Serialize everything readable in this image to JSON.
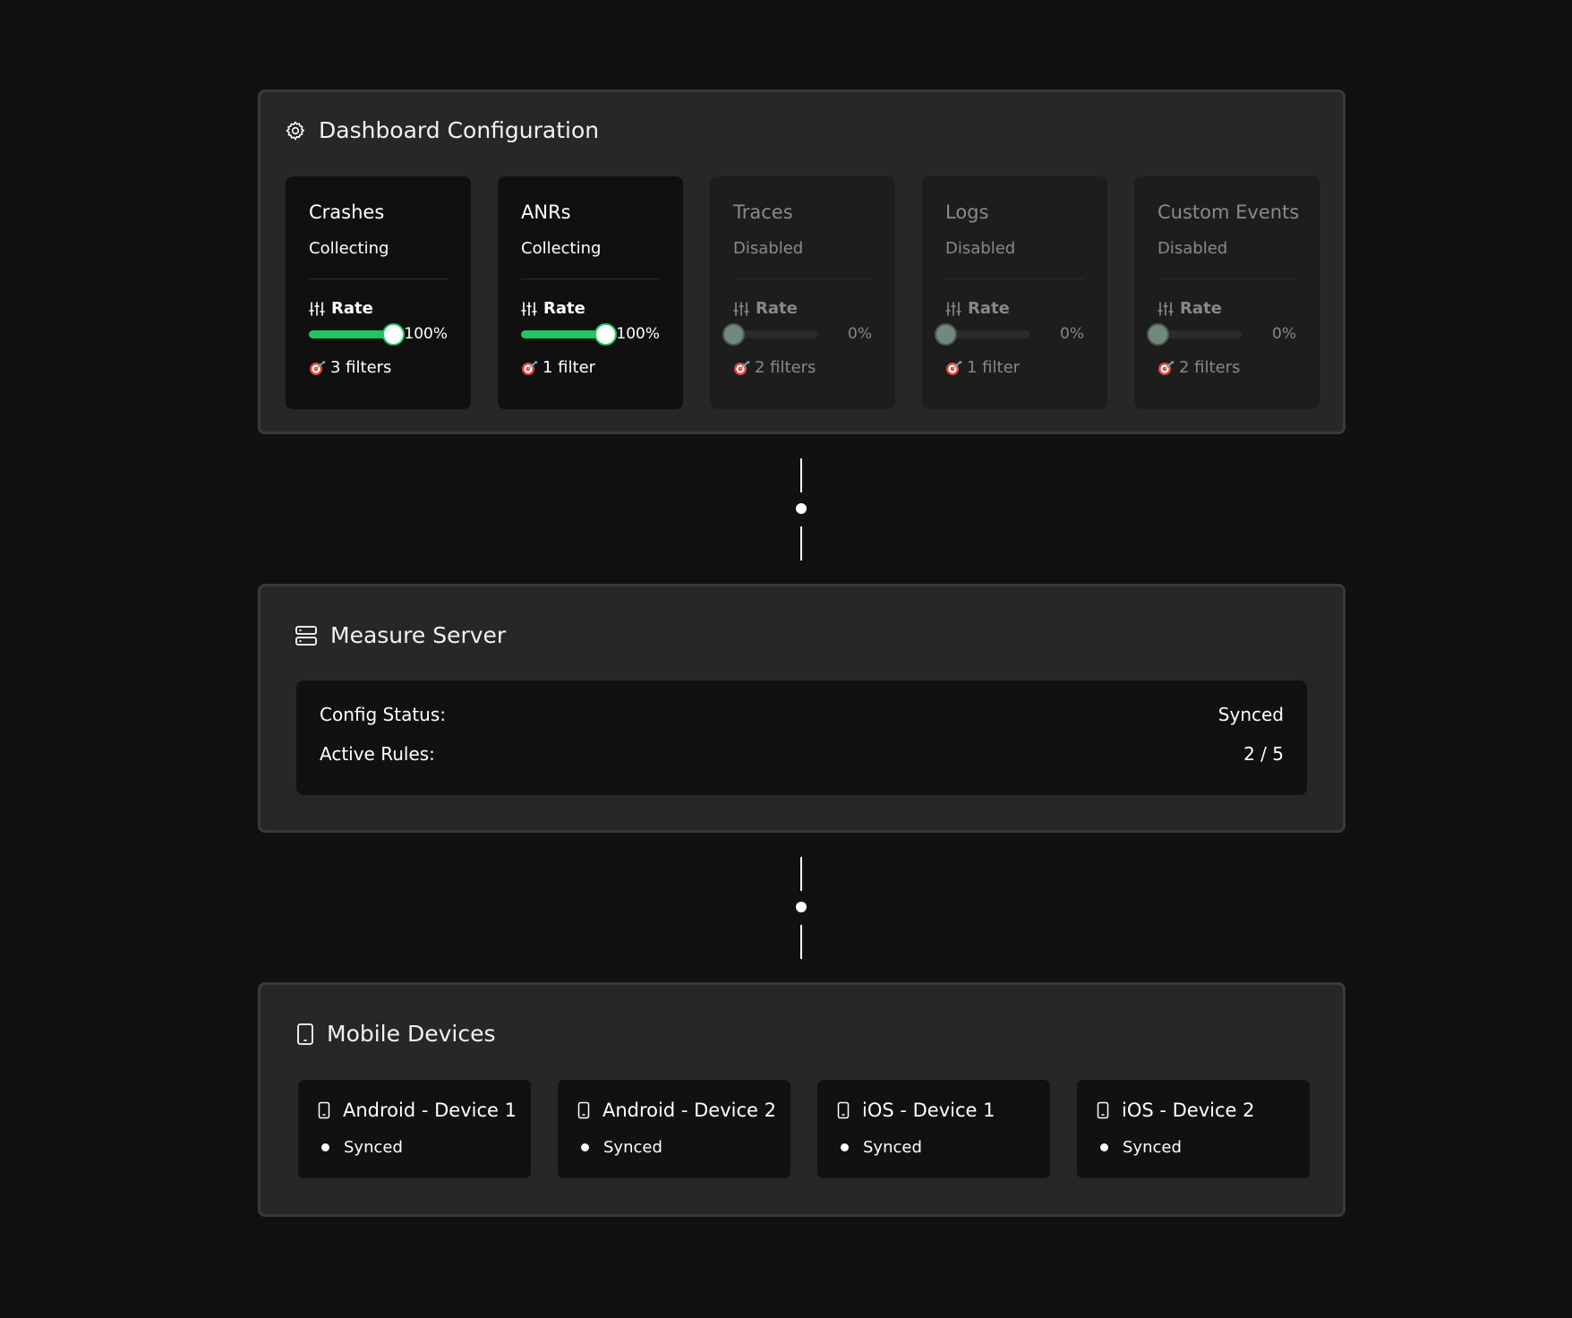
{
  "dashboard": {
    "title": "Dashboard Configuration",
    "rate_label": "Rate",
    "cards": [
      {
        "title": "Crashes",
        "status": "Collecting",
        "rate_text": "100%",
        "rate_value": 1.0,
        "filters": "3 filters",
        "enabled": true
      },
      {
        "title": "ANRs",
        "status": "Collecting",
        "rate_text": "100%",
        "rate_value": 1.0,
        "filters": "1 filter",
        "enabled": true
      },
      {
        "title": "Traces",
        "status": "Disabled",
        "rate_text": "0%",
        "rate_value": 0.0,
        "filters": "2 filters",
        "enabled": false
      },
      {
        "title": "Logs",
        "status": "Disabled",
        "rate_text": "0%",
        "rate_value": 0.0,
        "filters": "1 filter",
        "enabled": false
      },
      {
        "title": "Custom Events",
        "status": "Disabled",
        "rate_text": "0%",
        "rate_value": 0.0,
        "filters": "2 filters",
        "enabled": false
      }
    ]
  },
  "server": {
    "title": "Measure Server",
    "config_status_label": "Config Status:",
    "config_status_value": "Synced",
    "active_rules_label": "Active Rules:",
    "active_rules_value": "2 / 5"
  },
  "devices": {
    "title": "Mobile Devices",
    "items": [
      {
        "name": "Android - Device 1",
        "status": "Synced"
      },
      {
        "name": "Android - Device 2",
        "status": "Synced"
      },
      {
        "name": "iOS - Device 1",
        "status": "Synced"
      },
      {
        "name": "iOS - Device 2",
        "status": "Synced"
      }
    ]
  },
  "colors": {
    "accent": "#22c55e",
    "background": "#111111",
    "panel": "#272727"
  },
  "icons": {
    "dashboard": "gear-icon",
    "rate": "sliders-icon",
    "filters": "target-icon",
    "server": "server-icon",
    "device": "smartphone-icon"
  }
}
